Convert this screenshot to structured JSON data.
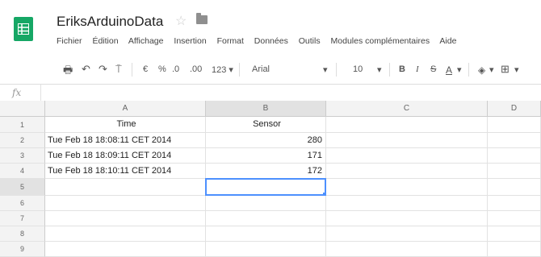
{
  "app": {
    "title": "EriksArduinoData",
    "star_icon": "star-icon",
    "folder_icon": "folder-icon",
    "logo_icon": "sheets-logo-icon",
    "brand_color": "#16a765"
  },
  "menu": [
    "Fichier",
    "Édition",
    "Affichage",
    "Insertion",
    "Format",
    "Données",
    "Outils",
    "Modules complémentaires",
    "Aide"
  ],
  "toolbar": {
    "print": "🖶",
    "undo": "↶",
    "redo": "↷",
    "paint_format": "⍑",
    "currency": "€",
    "percent": "%",
    "decrease_decimals": ".0",
    "increase_decimals": ".00",
    "more_formats": "123 ▾",
    "font": "Arial",
    "font_dropdown": "▾",
    "font_size": "10",
    "size_dropdown": "▾",
    "bold": "B",
    "italic": "I",
    "strike": "S",
    "text_color": "A",
    "text_color_dd": "▾",
    "fill_color": "◈",
    "fill_dd": "▾",
    "borders": "⊞",
    "borders_dd": "▾"
  },
  "formula_bar": {
    "fx": "fx",
    "value": ""
  },
  "columns": [
    "A",
    "B",
    "C",
    "D"
  ],
  "rows": [
    "1",
    "2",
    "3",
    "4",
    "5",
    "6",
    "7",
    "8",
    "9"
  ],
  "cells": {
    "A1": "Time",
    "B1": "Sensor",
    "A2": "Tue Feb 18 18:08:11 CET 2014",
    "B2": "280",
    "A3": "Tue Feb 18 18:09:11 CET 2014",
    "B3": "171",
    "A4": "Tue Feb 18 18:10:11 CET 2014",
    "B4": "172"
  },
  "selected_cell": "B5",
  "selection_color": "#4d90fe"
}
